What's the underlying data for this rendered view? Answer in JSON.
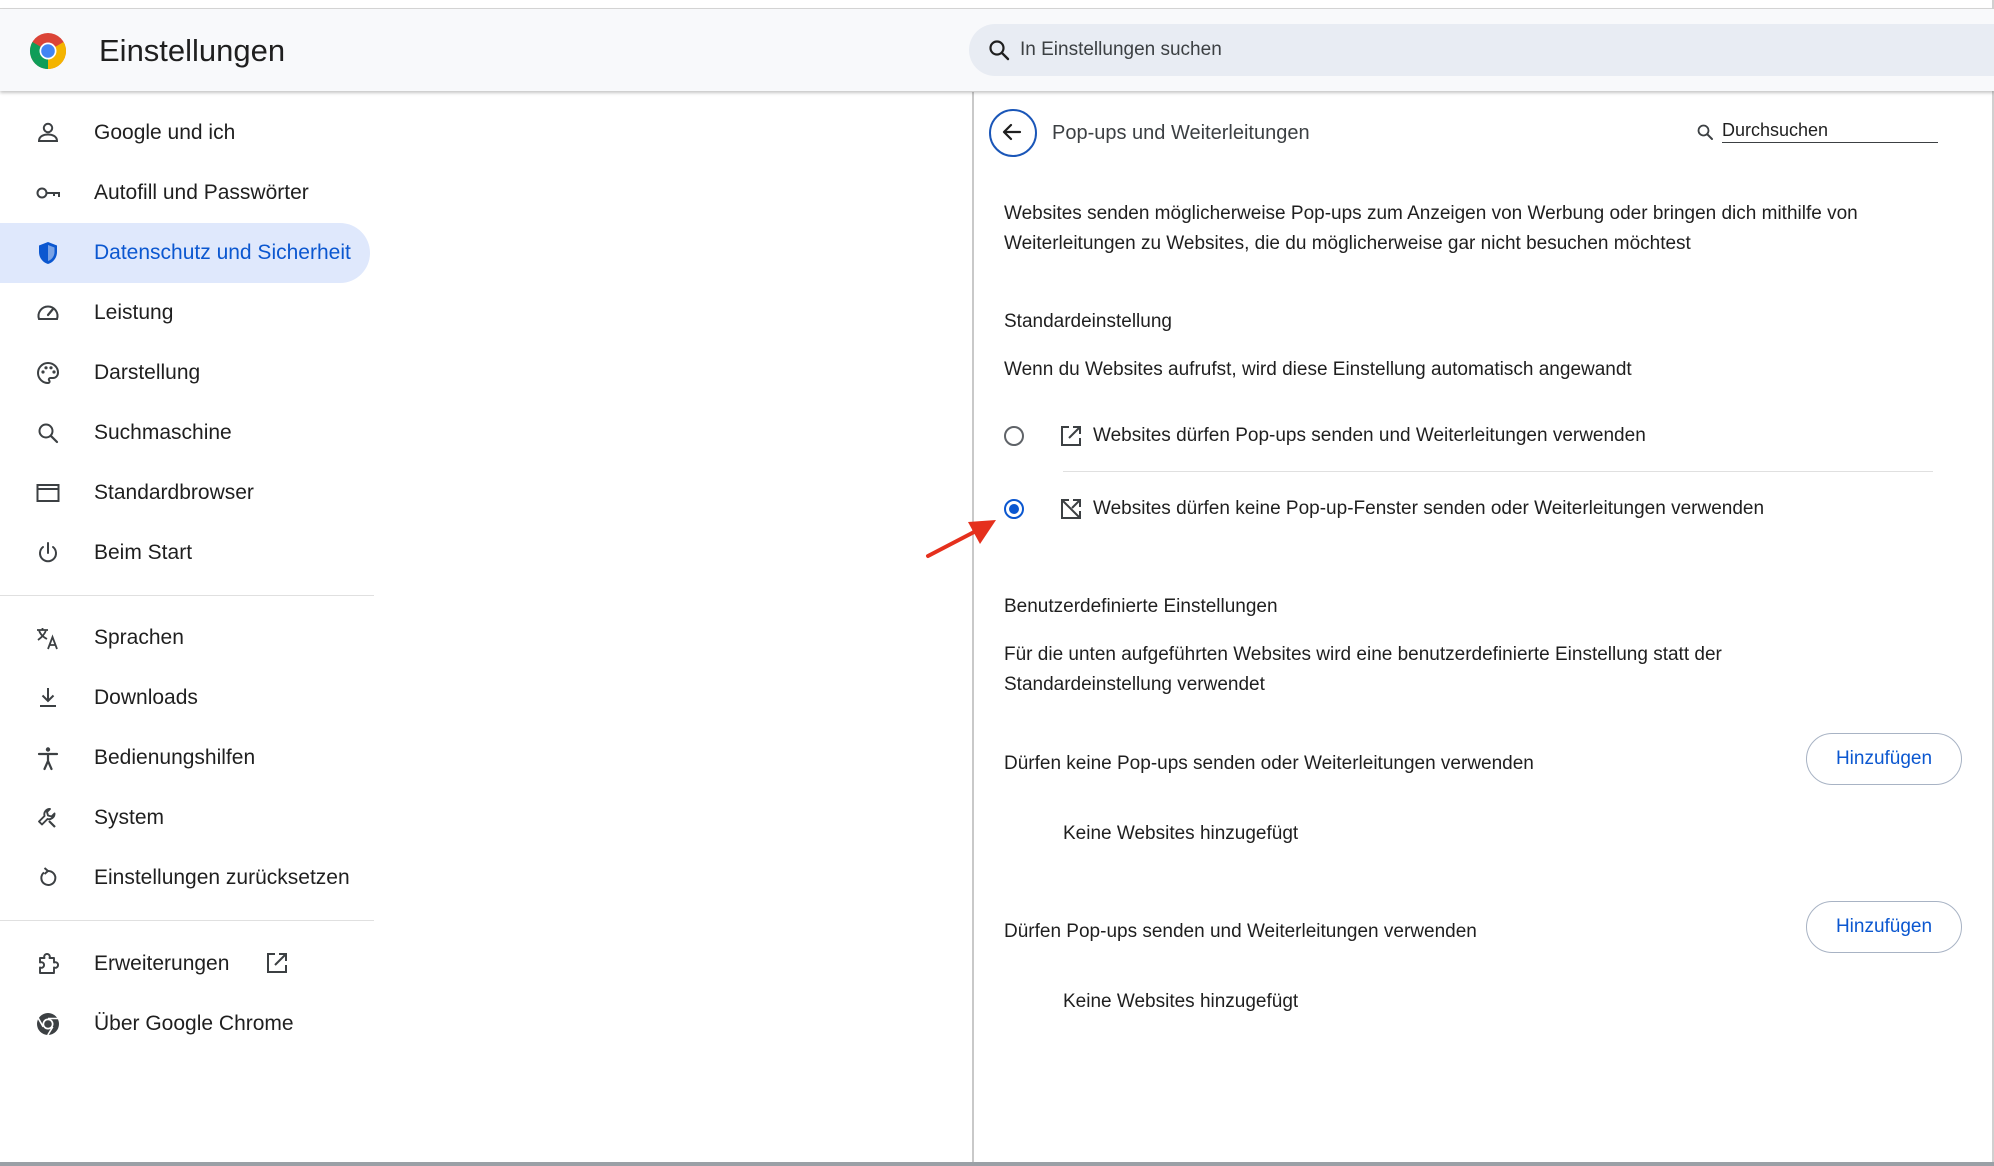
{
  "header": {
    "title": "Einstellungen",
    "search_placeholder": "In Einstellungen suchen"
  },
  "sidebar": {
    "items": [
      {
        "label": "Google und ich",
        "icon": "person-icon"
      },
      {
        "label": "Autofill und Passwörter",
        "icon": "key-icon"
      },
      {
        "label": "Datenschutz und Sicherheit",
        "icon": "shield-icon",
        "active": true
      },
      {
        "label": "Leistung",
        "icon": "speedometer-icon"
      },
      {
        "label": "Darstellung",
        "icon": "palette-icon"
      },
      {
        "label": "Suchmaschine",
        "icon": "search-icon"
      },
      {
        "label": "Standardbrowser",
        "icon": "browser-window-icon"
      },
      {
        "label": "Beim Start",
        "icon": "power-icon"
      },
      {
        "label": "Sprachen",
        "icon": "translate-icon"
      },
      {
        "label": "Downloads",
        "icon": "download-icon"
      },
      {
        "label": "Bedienungshilfen",
        "icon": "accessibility-icon"
      },
      {
        "label": "System",
        "icon": "wrench-icon"
      },
      {
        "label": "Einstellungen zurücksetzen",
        "icon": "reset-icon"
      },
      {
        "label": "Erweiterungen",
        "icon": "puzzle-icon"
      },
      {
        "label": "Über Google Chrome",
        "icon": "chrome-icon"
      }
    ]
  },
  "panel": {
    "title": "Pop-ups und Weiterleitungen",
    "search_placeholder": "Durchsuchen",
    "description": "Websites senden möglicherweise Pop-ups zum Anzeigen von Werbung oder bringen dich mithilfe von Weiterleitungen zu Websites, die du möglicherweise gar nicht besuchen möchtest",
    "default_heading": "Standardeinstellung",
    "default_desc": "Wenn du Websites aufrufst, wird diese Einstellung automatisch angewandt",
    "options": [
      {
        "label": "Websites dürfen Pop-ups senden und Weiterleitungen verwenden",
        "checked": false,
        "icon": "open-in-new-icon"
      },
      {
        "label": "Websites dürfen keine Pop-up-Fenster senden oder Weiterleitungen verwenden",
        "checked": true,
        "icon": "popup-blocked-icon"
      }
    ],
    "custom_heading": "Benutzerdefinierte Einstellungen",
    "custom_desc": "Für die unten aufgeführten Websites wird eine benutzerdefinierte Einstellung statt der Standardeinstellung verwendet",
    "block_section": {
      "label": "Dürfen keine Pop-ups senden oder Weiterleitungen verwenden",
      "button": "Hinzufügen",
      "empty": "Keine Websites hinzugefügt"
    },
    "allow_section": {
      "label": "Dürfen Pop-ups senden und Weiterleitungen verwenden",
      "button": "Hinzufügen",
      "empty": "Keine Websites hinzugefügt"
    }
  },
  "colors": {
    "accent": "#0b57d0",
    "active_nav_bg": "#dfe8fc",
    "annotation_arrow": "#e5301d"
  }
}
